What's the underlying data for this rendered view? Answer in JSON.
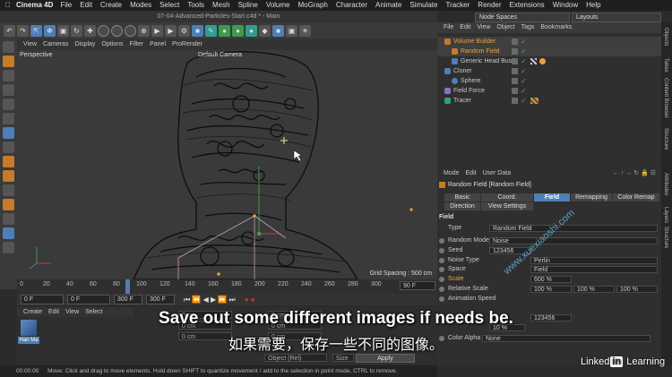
{
  "menubar": {
    "app_name": "Cinema 4D",
    "items": [
      "File",
      "Edit",
      "Create",
      "Modes",
      "Select",
      "Tools",
      "Mesh",
      "Spline",
      "Volume",
      "MoGraph",
      "Character",
      "Animate",
      "Simulate",
      "Tracker",
      "Render",
      "Extensions",
      "Window",
      "Help"
    ],
    "node_spaces": "Node Spaces",
    "layouts": "Layouts"
  },
  "document_title": "07-04-Advanced-Particles-Start.c4d * - Main",
  "viewport": {
    "menu": [
      "View",
      "Cameras",
      "Display",
      "Options",
      "Filter",
      "Panel",
      "ProRender"
    ],
    "label": "Perspective",
    "camera": "Default Camera",
    "grid_spacing": "Grid Spacing : 500 cm"
  },
  "timeline": {
    "ticks": [
      "0",
      "20",
      "40",
      "60",
      "80",
      "100",
      "120",
      "140",
      "160",
      "180",
      "200",
      "220",
      "240",
      "260",
      "280",
      "300"
    ],
    "current_frame": "90 F",
    "playhead_frame": 90,
    "max_frame": 300
  },
  "transport": {
    "start": "0 F",
    "current": "0 F",
    "end_a": "300 F",
    "end_b": "300 F"
  },
  "material_manager": {
    "menu": [
      "Create",
      "Edit",
      "View",
      "Select"
    ],
    "material_name": "Hair Ma"
  },
  "coordinates": {
    "values": [
      "0 cm",
      "0 cm",
      "0 cm",
      "0 cm",
      "0 cm",
      "0 cm"
    ],
    "mode": "Object (Rel)",
    "size_mode": "Size",
    "apply": "Apply"
  },
  "status": "Move: Click and drag to move elements. Hold down SHIFT to quantize movement / add to the selection in point mode, CTRL to remove.",
  "status_time": "00:00:00",
  "object_manager": {
    "menu": [
      "File",
      "Edit",
      "View",
      "Object",
      "Tags",
      "Bookmarks"
    ],
    "objects": [
      {
        "name": "Volume Builder",
        "color": "#c77a28",
        "highlight": true
      },
      {
        "name": "Random Field",
        "color": "#c77a28",
        "highlight": true
      },
      {
        "name": "Generic Head Bust",
        "color": "#4e7fb8",
        "highlight": false
      },
      {
        "name": "Cloner",
        "color": "#4e7fb8",
        "highlight": false
      },
      {
        "name": "Sphere",
        "color": "#4e7fb8",
        "highlight": false
      },
      {
        "name": "Field Force",
        "color": "#8a6fc8",
        "highlight": false
      },
      {
        "name": "Tracer",
        "color": "#2e9e8e",
        "highlight": false
      }
    ]
  },
  "side_tabs": [
    "Objects",
    "Takes",
    "Content Browser",
    "Structure",
    "Attributes",
    "Layers",
    "Structure"
  ],
  "attributes": {
    "menu": [
      "Mode",
      "Edit",
      "User Data"
    ],
    "title": "Random Field [Random Field]",
    "tabs_row1": [
      "Basic",
      "Coord.",
      "Field",
      "Remapping",
      "Color Remap"
    ],
    "tabs_row2": [
      "Direction",
      "View Settings"
    ],
    "active_tab": "Field",
    "section": "Field",
    "rows": [
      {
        "label": "Type",
        "value": "Random Field"
      },
      {
        "label": "Random Mode",
        "value": "Noise"
      },
      {
        "label": "Seed",
        "value": "123456"
      },
      {
        "label": "Noise Type",
        "value": "Perlin"
      },
      {
        "label": "Space",
        "value": "Field"
      },
      {
        "label": "Scale",
        "value": "600 %"
      },
      {
        "label": "Relative Scale",
        "value": "100 %"
      },
      {
        "label": "Animation Speed",
        "value": ""
      },
      {
        "label": "Color Alpha",
        "value": "None"
      }
    ],
    "relative_scale_b": "100 %",
    "relative_scale_c": "100 %",
    "variation_seed": "123456",
    "speed_value": "10 %"
  },
  "subtitle_en": "Save out some different images if needs be.",
  "subtitle_cn": "如果需要，保存一些不同的图像。",
  "brand": {
    "pre": "Linked",
    "in": "in",
    "post": " Learning"
  },
  "watermark": "www.xuexiaoshi.com"
}
